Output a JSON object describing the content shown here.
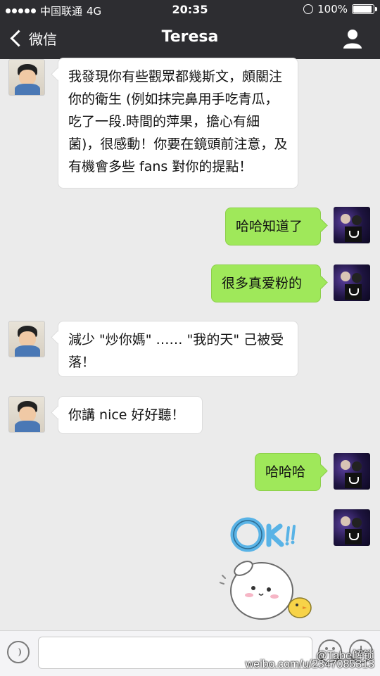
{
  "status_bar": {
    "carrier": "中国联通",
    "network": "4G",
    "time": "20:35",
    "battery": "100%",
    "battery_level": 1.0
  },
  "nav": {
    "back_label": "微信",
    "title": "Teresa",
    "profile_icon": "person-icon"
  },
  "messages": [
    {
      "sender": "Teresa",
      "side": "left",
      "text": "我發現你有些觀眾都幾斯文，頗關注你的衛生 (例如抹完鼻用手吃青瓜，吃了一段.時間的萍果，擔心有細菌)，很感動！你要在鏡頭前注意，及有機會多些 fans 對你的提點！"
    },
    {
      "sender": "me",
      "side": "right",
      "text": "哈哈知道了"
    },
    {
      "sender": "me",
      "side": "right",
      "text": "很多真爱粉的"
    },
    {
      "sender": "Teresa",
      "side": "left",
      "text": "減少 \"炒你媽\" …… \"我的天\" 己被受落！"
    },
    {
      "sender": "Teresa",
      "side": "left",
      "text": "你講 nice 好好聽！"
    },
    {
      "sender": "me",
      "side": "right",
      "text": "哈哈哈"
    },
    {
      "sender": "me",
      "side": "right",
      "type": "sticker",
      "sticker_text": "OK!!"
    }
  ],
  "input_bar": {
    "voice_icon": "voice-icon",
    "emoji_icon": "emoji-icon",
    "more_icon": "plus-icon"
  },
  "watermark": {
    "line1": "@Tabe解锁",
    "line2": "weibo.com/u/2347085313"
  },
  "colors": {
    "nav_bg": "#2d2d31",
    "chat_bg": "#ebebeb",
    "bubble_out": "#9fe85a",
    "bubble_in": "#ffffff"
  }
}
